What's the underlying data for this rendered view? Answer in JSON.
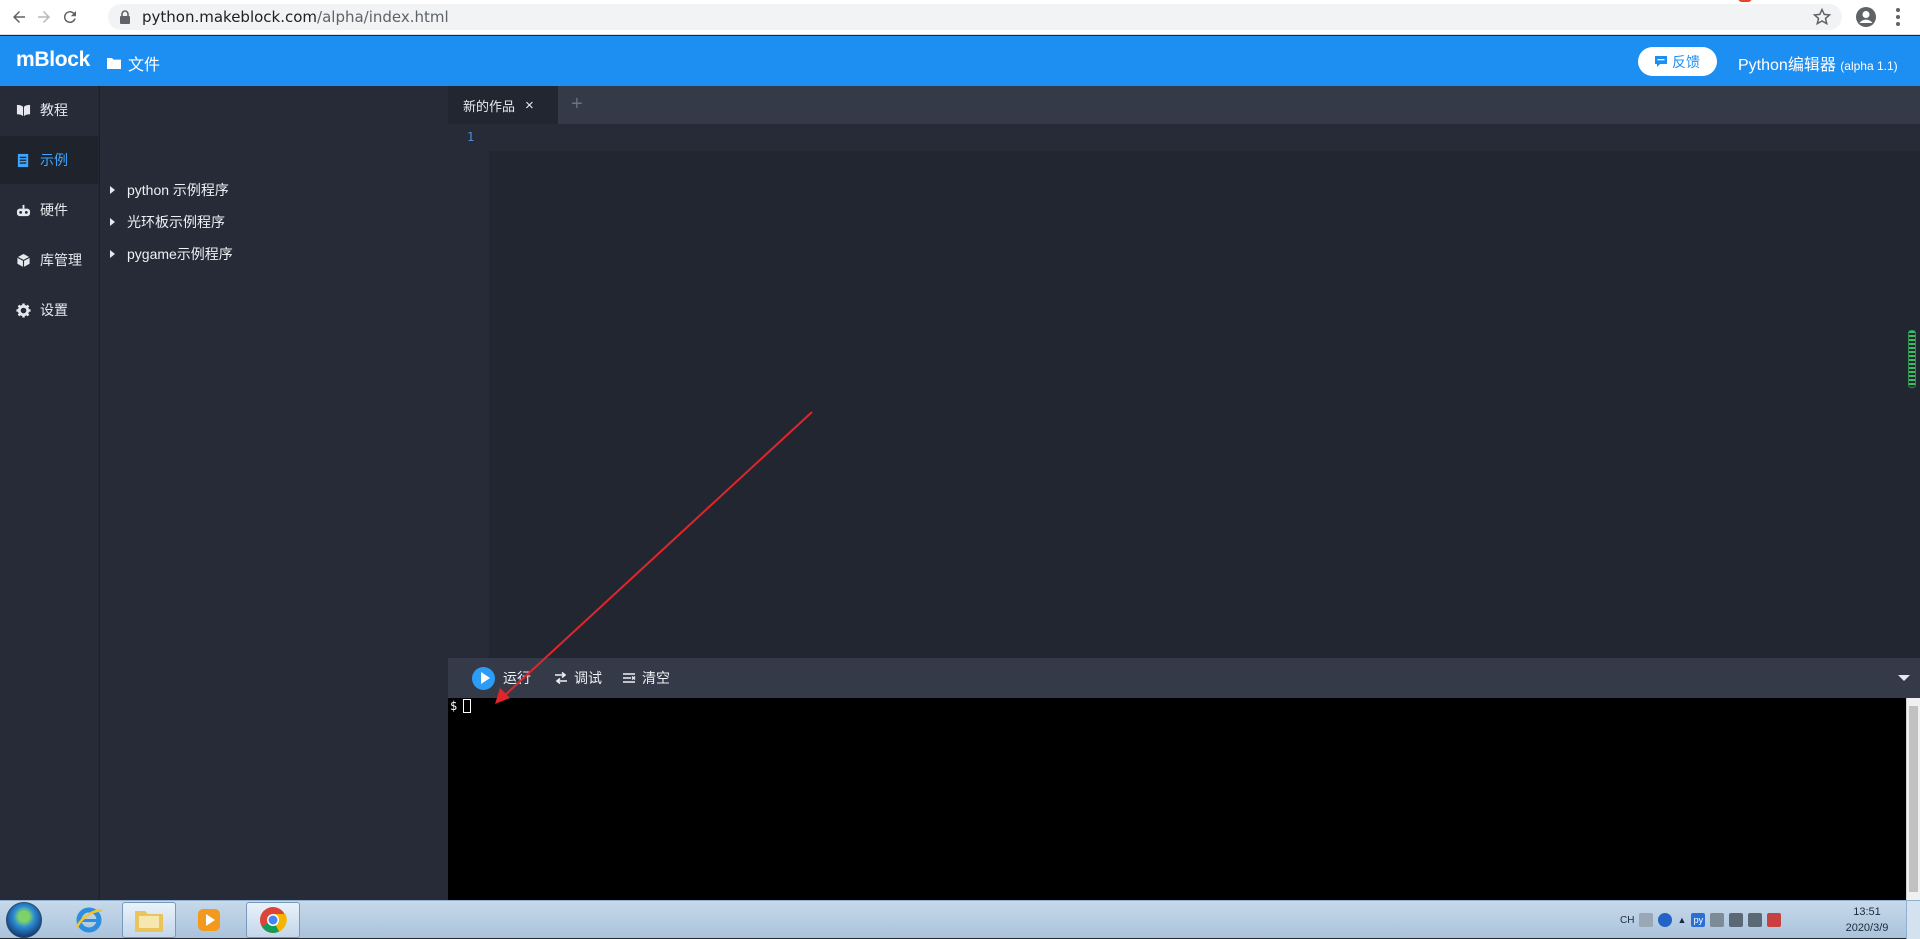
{
  "browser": {
    "url_host": "python.makeblock.com",
    "url_path": "/alpha/index.html"
  },
  "app": {
    "logo": "mBlock",
    "file_menu": "文件",
    "feedback_label": "反馈",
    "editor_title": "Python编辑器",
    "editor_version": "(alpha 1.1)"
  },
  "nav": {
    "items": [
      {
        "label": "教程",
        "icon": "book-icon"
      },
      {
        "label": "示例",
        "icon": "document-icon",
        "active": true
      },
      {
        "label": "硬件",
        "icon": "robot-icon"
      },
      {
        "label": "库管理",
        "icon": "package-icon"
      },
      {
        "label": "设置",
        "icon": "gear-icon"
      }
    ]
  },
  "tree": {
    "nodes": [
      {
        "label": "python 示例程序"
      },
      {
        "label": "光环板示例程序"
      },
      {
        "label": "pygame示例程序"
      }
    ]
  },
  "editor": {
    "tab_label": "新的作品",
    "tab_close": "×",
    "add_tab": "+",
    "line_numbers": [
      "1"
    ]
  },
  "console": {
    "run_label": "运行",
    "debug_label": "调试",
    "clear_label": "清空",
    "prompt": "$"
  },
  "taskbar": {
    "tray_lang": "CH",
    "tray_ime": "py",
    "time": "13:51",
    "date": "2020/3/9"
  },
  "colors": {
    "brand_blue": "#1e8ff2",
    "editor_bg": "#222630",
    "panel_bg": "#272b37",
    "toolbar_bg": "#343a48",
    "annotation_arrow": "#e0262a"
  }
}
